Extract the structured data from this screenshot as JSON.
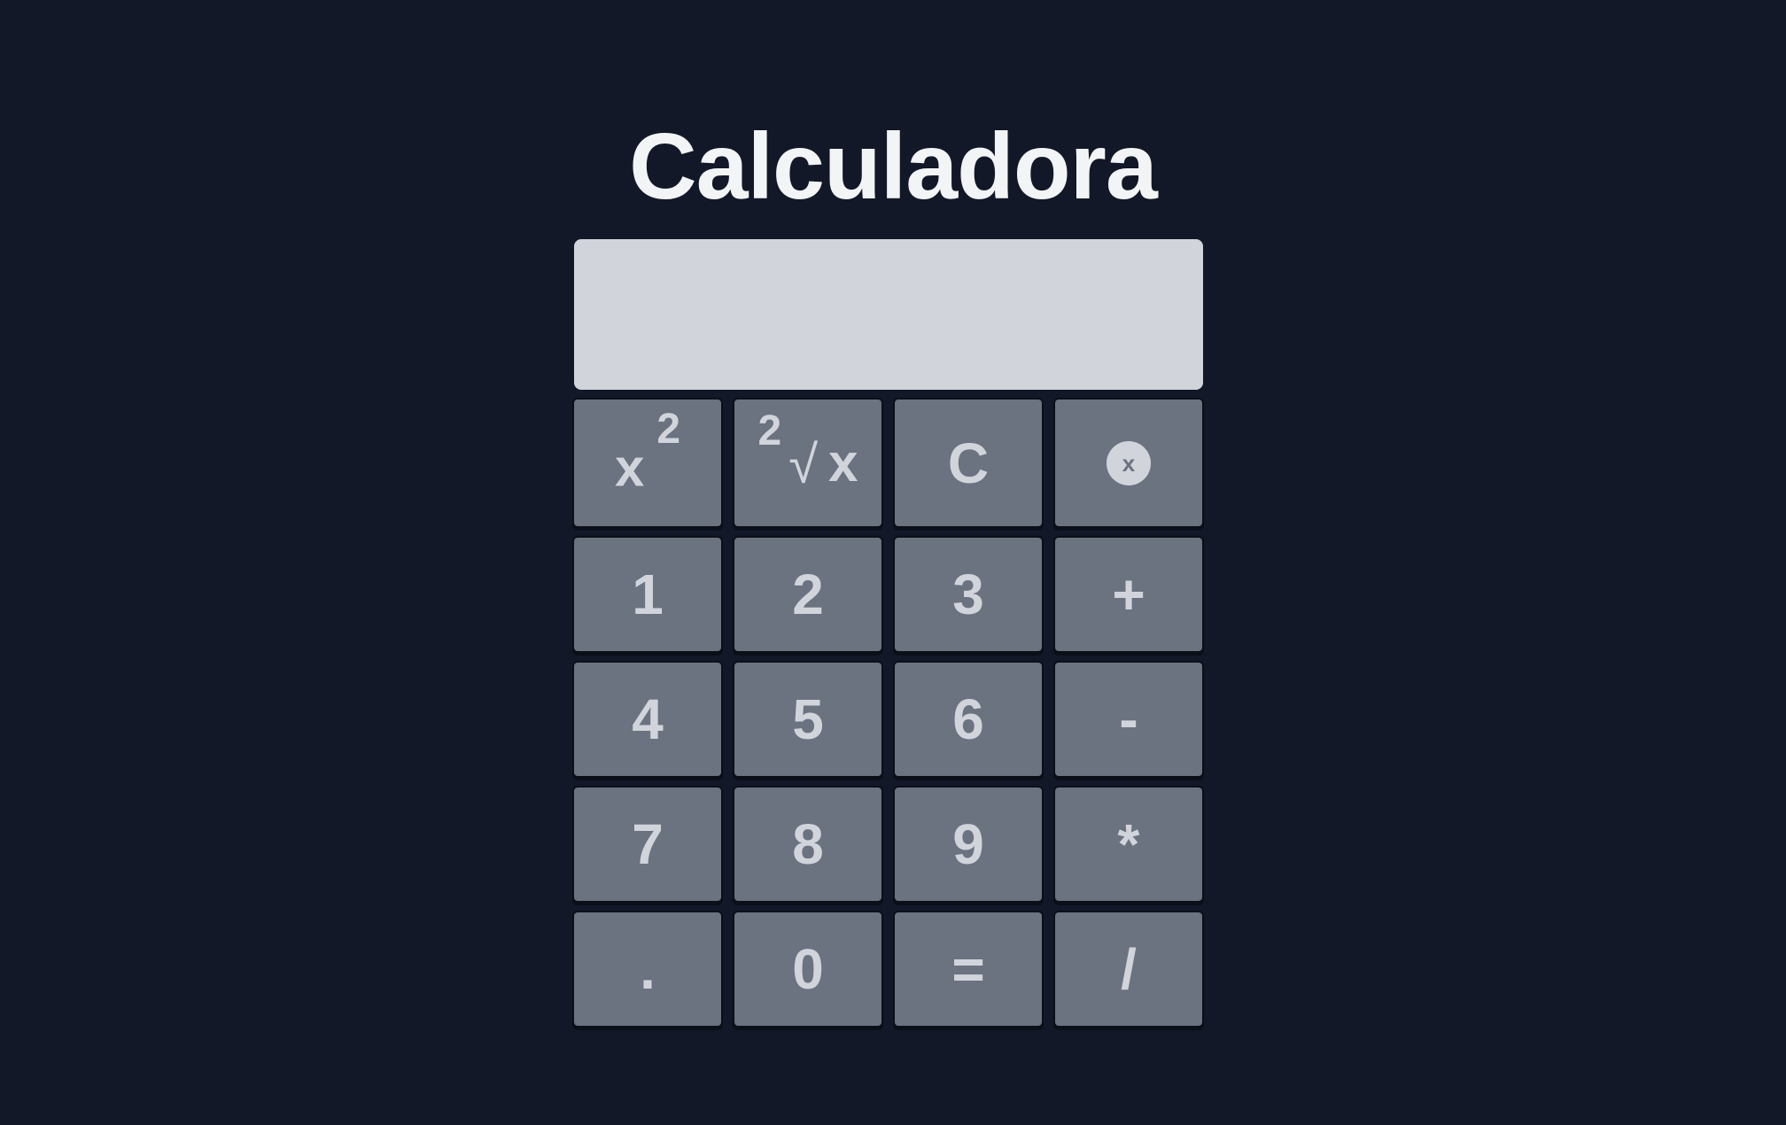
{
  "app": {
    "title": "Calculadora"
  },
  "display": {
    "value": ""
  },
  "keys": {
    "square": {
      "base": "x",
      "exponent": "2"
    },
    "square_root": {
      "index": "2",
      "radical": "√",
      "base": "x"
    },
    "clear": "C",
    "delete": {
      "icon": "circle-x-icon",
      "glyph": "x"
    },
    "one": "1",
    "two": "2",
    "three": "3",
    "plus": "+",
    "four": "4",
    "five": "5",
    "six": "6",
    "minus": "-",
    "seven": "7",
    "eight": "8",
    "nine": "9",
    "multiply": "*",
    "dot": ".",
    "zero": "0",
    "equals": "=",
    "divide": "/"
  },
  "colors": {
    "background": "#121827",
    "display": "#d1d5db",
    "key": "#6b7280",
    "key_text": "#d1d5db",
    "title": "#f3f4f6"
  }
}
